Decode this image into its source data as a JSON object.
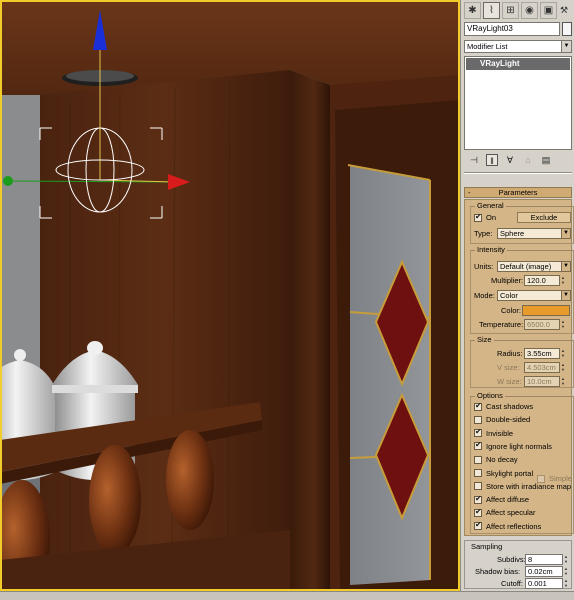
{
  "colors": {
    "viewport_border": "#f1cc2a",
    "rollout_bg": "#d4b587",
    "gizmo_x": "#d81b1b",
    "gizmo_y": "#1c9c1c",
    "gizmo_z": "#1b2fd8",
    "light_color": "#e89a2a"
  },
  "tabs": [
    {
      "icon": "create-panel-icon"
    },
    {
      "icon": "modify-panel-icon"
    },
    {
      "icon": "hierarchy-panel-icon"
    },
    {
      "icon": "motion-panel-icon"
    },
    {
      "icon": "display-panel-icon"
    },
    {
      "icon": "utilities-panel-icon"
    }
  ],
  "object": {
    "name": "VRayLight03",
    "modifier_list": "Modifier List",
    "stack_item": "VRayLight"
  },
  "parameters": {
    "title": "Parameters",
    "general": {
      "title": "General",
      "on_label": "On",
      "on_checked": true,
      "exclude_label": "Exclude",
      "type_label": "Type:",
      "type_value": "Sphere"
    },
    "intensity": {
      "title": "Intensity",
      "units_label": "Units:",
      "units_value": "Default (image)",
      "multiplier_label": "Multiplier:",
      "multiplier_value": "120.0",
      "mode_label": "Mode:",
      "mode_value": "Color",
      "color_label": "Color:",
      "temperature_label": "Temperature:",
      "temperature_value": "6500.0"
    },
    "size": {
      "title": "Size",
      "radius_label": "Radius:",
      "radius_value": "3.55cm",
      "vsize_label": "V size:",
      "vsize_value": "4.503cm",
      "wsize_label": "W size:",
      "wsize_value": "10.0cm"
    },
    "options": {
      "title": "Options",
      "items": [
        {
          "label": "Cast shadows",
          "checked": true
        },
        {
          "label": "Double-sided",
          "checked": false
        },
        {
          "label": "Invisible",
          "checked": true
        },
        {
          "label": "Ignore light normals",
          "checked": true
        },
        {
          "label": "No decay",
          "checked": false
        },
        {
          "label": "Skylight portal",
          "checked": false
        },
        {
          "label": "Store with irradiance map",
          "checked": false
        },
        {
          "label": "Affect diffuse",
          "checked": true
        },
        {
          "label": "Affect specular",
          "checked": true
        },
        {
          "label": "Affect reflections",
          "checked": true
        }
      ],
      "simple_label": "Simple"
    }
  },
  "sampling": {
    "title": "Sampling",
    "subdivs_label": "Subdivs:",
    "subdivs_value": "8",
    "shadow_bias_label": "Shadow bias:",
    "shadow_bias_value": "0.02cm",
    "cutoff_label": "Cutoff:",
    "cutoff_value": "0.001"
  }
}
